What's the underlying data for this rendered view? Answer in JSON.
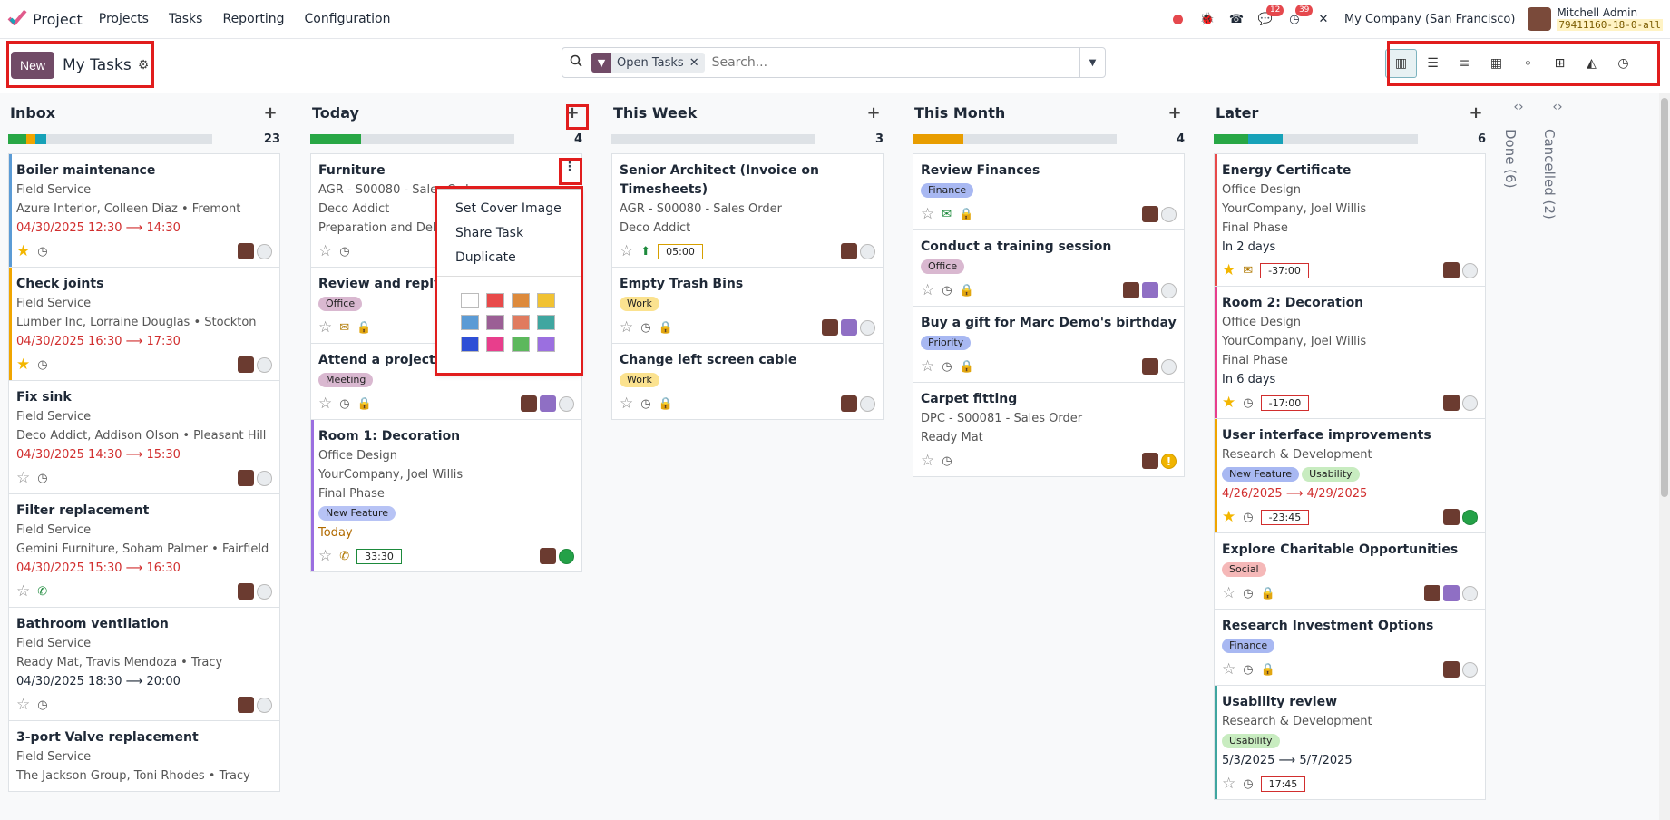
{
  "app": {
    "name": "Project"
  },
  "menu": [
    "Projects",
    "Tasks",
    "Reporting",
    "Configuration"
  ],
  "topbar": {
    "badges": {
      "chat": "12",
      "activity": "39"
    },
    "company": "My Company (San Francisco)",
    "user": "Mitchell Admin",
    "db": "79411160-18-0-all"
  },
  "control": {
    "new_label": "New",
    "title": "My Tasks",
    "facet": "Open Tasks",
    "search_placeholder": "Search..."
  },
  "views": [
    "kanban-icon",
    "list-icon",
    "gantt-icon",
    "calendar-icon",
    "map-icon",
    "pivot-icon",
    "graph-icon",
    "activity-icon"
  ],
  "columns": [
    {
      "title": "Inbox",
      "count": "23"
    },
    {
      "title": "Today",
      "count": "4"
    },
    {
      "title": "This Week",
      "count": "3"
    },
    {
      "title": "This Month",
      "count": "4"
    },
    {
      "title": "Later",
      "count": "6"
    }
  ],
  "folded": [
    {
      "title": "Done (6)"
    },
    {
      "title": "Cancelled (2)"
    }
  ],
  "cards": {
    "inbox": [
      {
        "title": "Boiler maintenance",
        "sub": "Field Service",
        "meta": "Azure Interior, Colleen Diaz • Fremont",
        "start": "04/30/2025 12:30",
        "end": "14:30"
      },
      {
        "title": "Check joints",
        "sub": "Field Service",
        "meta": "Lumber Inc, Lorraine Douglas • Stockton",
        "start": "04/30/2025 16:30",
        "end": "17:30"
      },
      {
        "title": "Fix sink",
        "sub": "Field Service",
        "meta": "Deco Addict, Addison Olson • Pleasant Hill",
        "start": "04/30/2025 14:30",
        "end": "15:30"
      },
      {
        "title": "Filter replacement",
        "sub": "Field Service",
        "meta": "Gemini Furniture, Soham Palmer • Fairfield",
        "start": "04/30/2025 15:30",
        "end": "16:30"
      },
      {
        "title": "Bathroom ventilation",
        "sub": "Field Service",
        "meta": "Ready Mat, Travis Mendoza • Tracy",
        "start": "04/30/2025 18:30",
        "end": "20:00"
      },
      {
        "title": "3-port Valve replacement",
        "sub": "Field Service",
        "meta": "The Jackson Group, Toni Rhodes • Tracy"
      }
    ],
    "today": [
      {
        "title": "Furniture",
        "l1": "AGR - S00080 - Sales Order",
        "l2": "Deco Addict",
        "l3": "Preparation and Delivery"
      },
      {
        "title": "Review and reply to all emails",
        "tag": "Office"
      },
      {
        "title": "Attend a project status meeting",
        "tag": "Meeting"
      },
      {
        "title": "Room 1: Decoration",
        "l1": "Office Design",
        "l2": "YourCompany, Joel Willis",
        "l3": "Final Phase",
        "tag": "New Feature",
        "when": "Today",
        "timer": "33:30"
      }
    ],
    "week": [
      {
        "title": "Senior Architect (Invoice on Timesheets)",
        "l1": "AGR - S00080 - Sales Order",
        "l2": "Deco Addict",
        "timer": "05:00"
      },
      {
        "title": "Empty Trash Bins",
        "tag": "Work"
      },
      {
        "title": "Change left screen cable",
        "tag": "Work"
      }
    ],
    "month": [
      {
        "title": "Review Finances",
        "tag": "Finance"
      },
      {
        "title": "Conduct a training session",
        "tag": "Office"
      },
      {
        "title": "Buy a gift for Marc Demo's birthday",
        "tag": "Priority"
      },
      {
        "title": "Carpet fitting",
        "l1": "DPC - S00081 - Sales Order",
        "l2": "Ready Mat"
      }
    ],
    "later": [
      {
        "title": "Energy Certificate",
        "l1": "Office Design",
        "l2": "YourCompany, Joel Willis",
        "l3": "Final Phase",
        "when": "In 2 days",
        "timer": "-37:00"
      },
      {
        "title": "Room 2: Decoration",
        "l1": "Office Design",
        "l2": "YourCompany, Joel Willis",
        "l3": "Final Phase",
        "when": "In 6 days",
        "timer": "-17:00"
      },
      {
        "title": "User interface improvements",
        "l1": "Research & Development",
        "tag": "New Feature",
        "tag2": "Usability",
        "start": "4/26/2025",
        "end": "4/29/2025",
        "timer": "-23:45"
      },
      {
        "title": "Explore Charitable Opportunities",
        "tag": "Social"
      },
      {
        "title": "Research Investment Options",
        "tag": "Finance"
      },
      {
        "title": "Usability review",
        "l1": "Research & Development",
        "tag": "Usability",
        "start": "5/3/2025",
        "end": "5/7/2025",
        "timer": "17:45"
      }
    ]
  },
  "dropdown": {
    "items": [
      "Set Cover Image",
      "Share Task",
      "Duplicate"
    ],
    "colors": [
      "#ffffff",
      "#e84a4a",
      "#dd8a3c",
      "#f1c232",
      "#5b9bd5",
      "#9b5f95",
      "#e07b5f",
      "#3fa6a0",
      "#2e4fd6",
      "#e83e8c",
      "#5cb85c",
      "#9b6fe0"
    ]
  },
  "colors": {
    "accent": "#714b67",
    "highlight": "#e11d1d"
  }
}
